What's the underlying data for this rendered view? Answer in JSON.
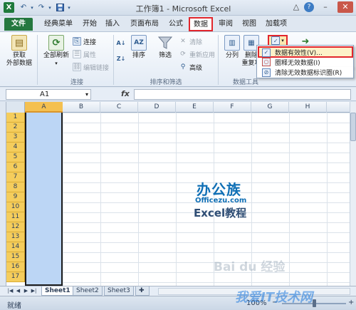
{
  "window": {
    "title": "工作簿1 - Microsoft Excel",
    "logo": "X",
    "min": "–",
    "help": "?",
    "close": "✕"
  },
  "tabs": [
    "文件",
    "经典菜单",
    "开始",
    "插入",
    "页面布局",
    "公式",
    "数据",
    "审阅",
    "视图",
    "加载项"
  ],
  "ribbon": {
    "get_external": "获取\n外部数据",
    "refresh_all": "全部刷新",
    "connections": "连接",
    "properties": "属性",
    "edit_links": "编辑链接",
    "group_connections": "连接",
    "sort": "排序",
    "filter": "筛选",
    "clear": "清除",
    "reapply": "重新应用",
    "advanced": "高级",
    "group_sort_filter": "排序和筛选",
    "text_to_columns": "分列",
    "remove_dup": "删除\n重复项",
    "group_data_tools": "数据工具"
  },
  "dropdown": {
    "items": [
      "数据有效性(V)...",
      "圈释无效数据(I)",
      "清除无效数据标识圈(R)"
    ]
  },
  "formula_bar": {
    "name_box": "A1",
    "fx": "fx"
  },
  "grid": {
    "columns": [
      "A",
      "B",
      "C",
      "D",
      "E",
      "F",
      "G",
      "H"
    ],
    "rows": [
      "1",
      "2",
      "3",
      "4",
      "5",
      "6",
      "7",
      "8",
      "9",
      "10",
      "11",
      "12",
      "13",
      "14",
      "15",
      "16",
      "17"
    ]
  },
  "watermark": {
    "main": "办公族",
    "site": "Officezu.com",
    "sub": "Excel教程",
    "baidu": "Bai du 经验",
    "bottom": "我爱IT技术网"
  },
  "sheets": [
    "Sheet1",
    "Sheet2",
    "Sheet3"
  ],
  "status": {
    "ready": "就绪",
    "zoom": "100%",
    "zoom_level": 0.5
  },
  "colors": {
    "file_tab": "#25783f",
    "highlight": "#e2262c",
    "selection": "#bcd6f5",
    "row_header": "#f5cd5c"
  }
}
